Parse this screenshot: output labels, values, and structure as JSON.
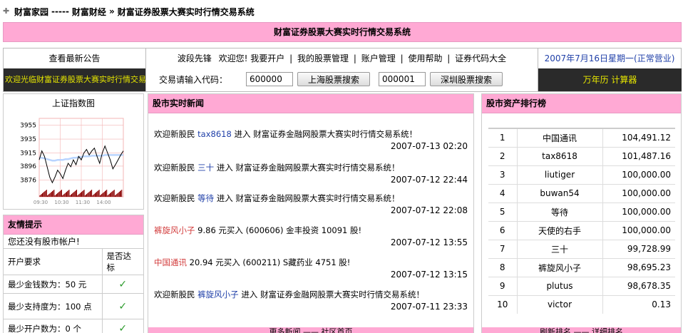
{
  "breadcrumb": {
    "home": "财富家园",
    "sep": "-----",
    "section": "财富财经",
    "arrow": "»",
    "page": "财富证券股票大赛实时行情交易系统"
  },
  "banner": {
    "title": "财富证券股票大赛实时行情交易系统"
  },
  "notice": {
    "title": "查看最新公告",
    "marquee": "欢迎光临财富证券股票大赛实时行情交易系统"
  },
  "nav": {
    "brand": "波段先锋",
    "welcome": "欢迎您!",
    "links": [
      "我要开户",
      "我的股票管理",
      "账户管理",
      "使用帮助",
      "证券代码大全"
    ],
    "sep": "|",
    "code_label": "交易请输入代码：",
    "sh_value": "600000",
    "sh_button": "上海股票搜索",
    "sz_value": "000001",
    "sz_button": "深圳股票搜索"
  },
  "datebox": {
    "date": "2007年7月16日星期一(正常营业)",
    "tools": "万年历 计算器"
  },
  "index_chart": {
    "title": "上证指数图",
    "y_ticks": [
      "3955",
      "3935",
      "3915",
      "3896",
      "3876"
    ],
    "x_ticks": [
      "09:30",
      "10:30",
      "11:30",
      "14:00"
    ],
    "colors": {
      "price": "#000000",
      "avg": "#b9d4ff",
      "volume": "#8b0000",
      "grid": "#f3b4b4"
    }
  },
  "chart_data": {
    "type": "line",
    "title": "上证指数图",
    "xlabel": "",
    "ylabel": "",
    "x_ticks": [
      "09:30",
      "10:30",
      "11:30",
      "14:00"
    ],
    "ylim": [
      3866,
      3965
    ],
    "series": [
      {
        "values": [
          3905,
          3918,
          3910,
          3895,
          3880,
          3872,
          3880,
          3890,
          3885,
          3878,
          3890,
          3900,
          3895,
          3905,
          3898,
          3910,
          3905,
          3915,
          3920,
          3912,
          3918,
          3922,
          3910,
          3900,
          3915,
          3925,
          3915,
          3905,
          3892,
          3898,
          3905,
          3912,
          3918
        ]
      },
      {
        "values": [
          3908,
          3908,
          3907,
          3906,
          3905,
          3904,
          3904,
          3905,
          3905,
          3905,
          3906,
          3906,
          3907,
          3908,
          3908,
          3909,
          3909,
          3910,
          3910,
          3910,
          3911,
          3911,
          3911,
          3911,
          3911,
          3912,
          3912,
          3912,
          3912,
          3912,
          3912,
          3912,
          3912
        ]
      }
    ]
  },
  "tips": {
    "title": "友情提示",
    "message": "您还没有股市帐户!",
    "col1": "开户要求",
    "col2": "是否达标",
    "rows": [
      {
        "req": "最少金钱数为：50 元",
        "ok": "✓"
      },
      {
        "req": "最少支持度为：100 点",
        "ok": "✓"
      },
      {
        "req": "最少开户数为：0 个",
        "ok": "✓"
      }
    ]
  },
  "news": {
    "title": "股市实时新闻",
    "items": [
      {
        "pre": "欢迎新股民",
        "name": "tax8618",
        "post": "进入 财富证券金融网股票大赛实时行情交易系统！",
        "time": "2007-07-13 02:20",
        "style": "blue"
      },
      {
        "pre": "欢迎新股民",
        "name": "三十",
        "post": "进入 财富证券金融网股票大赛实时行情交易系统！",
        "time": "2007-07-12 22:44",
        "style": "blue"
      },
      {
        "pre": "欢迎新股民",
        "name": "等待",
        "post": "进入 财富证券金融网股票大赛实时行情交易系统！",
        "time": "2007-07-12 22:08",
        "style": "blue"
      },
      {
        "pre": "",
        "name": "裤旋风小子",
        "post": "9.86 元买入 (600606) 金丰投资 10091 股!",
        "time": "2007-07-12 13:55",
        "style": "red"
      },
      {
        "pre": "",
        "name": "中国通讯",
        "post": "20.94 元买入 (600211) S藏药业 4751 股!",
        "time": "2007-07-12 13:15",
        "style": "red"
      },
      {
        "pre": "欢迎新股民",
        "name": "裤旋风小子",
        "post": "进入 财富证券金融网股票大赛实时行情交易系统！",
        "time": "2007-07-11 23:33",
        "style": "blue"
      }
    ],
    "footer": "更多新闻 —— 社区首页"
  },
  "ranking": {
    "title": "股市资产排行榜",
    "rows": [
      {
        "rank": "1",
        "name": "中国通讯",
        "value": "104,491.12"
      },
      {
        "rank": "2",
        "name": "tax8618",
        "value": "101,487.16"
      },
      {
        "rank": "3",
        "name": "liutiger",
        "value": "100,000.00"
      },
      {
        "rank": "4",
        "name": "buwan54",
        "value": "100,000.00"
      },
      {
        "rank": "5",
        "name": "等待",
        "value": "100,000.00"
      },
      {
        "rank": "6",
        "name": "天使的右手",
        "value": "100,000.00"
      },
      {
        "rank": "7",
        "name": "三十",
        "value": "99,728.99"
      },
      {
        "rank": "8",
        "name": "裤旋风小子",
        "value": "98,695.23"
      },
      {
        "rank": "9",
        "name": "plutus",
        "value": "98,678.35"
      },
      {
        "rank": "10",
        "name": "victor",
        "value": "0.13"
      }
    ],
    "footer": "刷新排名 —— 详细排名"
  }
}
